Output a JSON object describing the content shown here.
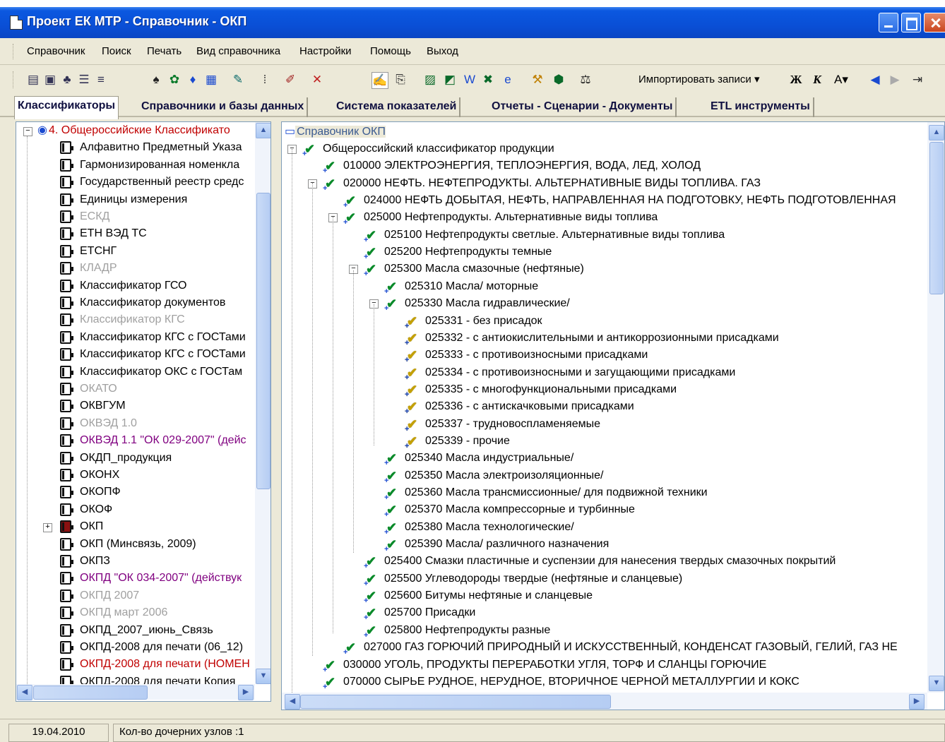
{
  "window": {
    "title": "Проект ЕК МТР - Справочник - ОКП"
  },
  "menu": [
    "Справочник",
    "Поиск",
    "Печать",
    "Вид справочника",
    "Настройки",
    "Помощь",
    "Выход"
  ],
  "toolbar": {
    "import_label": "Импортировать записи",
    "bold": "Ж",
    "italic": "К",
    "font": "А"
  },
  "tabs": [
    "Классификаторы",
    "Справочники и базы данных",
    "Система показателей",
    "Отчеты - Сценарии - Документы",
    "ETL инструменты"
  ],
  "left_tree": {
    "root": "4. Общероссийские Классификато",
    "items": [
      {
        "label": "Алфавитно Предметный Указа",
        "style": "normal"
      },
      {
        "label": "Гармонизированная номенкла",
        "style": "normal"
      },
      {
        "label": "Государственный реестр средс",
        "style": "normal"
      },
      {
        "label": "Единицы измерения",
        "style": "normal"
      },
      {
        "label": "ЕСКД",
        "style": "gray"
      },
      {
        "label": "ЕТН ВЭД ТС",
        "style": "normal"
      },
      {
        "label": "ЕТСНГ",
        "style": "normal"
      },
      {
        "label": "КЛАДР",
        "style": "gray"
      },
      {
        "label": "Классификатор ГСО",
        "style": "normal"
      },
      {
        "label": "Классификатор документов",
        "style": "normal"
      },
      {
        "label": "Классификатор КГС",
        "style": "gray"
      },
      {
        "label": "Классификатор КГС с ГОСТами",
        "style": "normal"
      },
      {
        "label": "Классификатор КГС с ГОСТами",
        "style": "normal"
      },
      {
        "label": "Классификатор ОКС с ГОСТам",
        "style": "normal"
      },
      {
        "label": "ОКАТО",
        "style": "gray"
      },
      {
        "label": "ОКВГУМ",
        "style": "normal"
      },
      {
        "label": "ОКВЭД 1.0",
        "style": "gray"
      },
      {
        "label": "ОКВЭД 1.1 \"ОК 029-2007\" (дейс",
        "style": "purple"
      },
      {
        "label": "ОКДП_продукция",
        "style": "normal"
      },
      {
        "label": "ОКОНХ",
        "style": "normal"
      },
      {
        "label": "ОКОПФ",
        "style": "normal"
      },
      {
        "label": "ОКОФ",
        "style": "normal"
      },
      {
        "label": "ОКП",
        "style": "selected"
      },
      {
        "label": "ОКП (Минсвязь, 2009)",
        "style": "normal"
      },
      {
        "label": "ОКПЗ",
        "style": "normal"
      },
      {
        "label": "ОКПД \"ОК 034-2007\" (действук",
        "style": "purple"
      },
      {
        "label": "ОКПД 2007",
        "style": "gray"
      },
      {
        "label": "ОКПД март 2006",
        "style": "gray"
      },
      {
        "label": "ОКПД_2007_июнь_Связь",
        "style": "normal"
      },
      {
        "label": "ОКПД-2008 для печати (06_12)",
        "style": "normal"
      },
      {
        "label": "ОКПД-2008 для печати (НОМЕН",
        "style": "red"
      },
      {
        "label": "ОКПД-2008 для печати Копия",
        "style": "normal"
      }
    ]
  },
  "right_tree": {
    "root": "Справочник ОКП",
    "items": [
      {
        "label": "Общероссийский классификатор продукции",
        "level": 0,
        "exp": "-",
        "icon": "green"
      },
      {
        "label": "010000 ЭЛЕКТРОЭНЕРГИЯ, ТЕПЛОЭНЕРГИЯ, ВОДА, ЛЕД, ХОЛОД",
        "level": 1,
        "exp": "",
        "icon": "green"
      },
      {
        "label": "020000 НЕФТЬ. НЕФТЕПРОДУКТЫ. АЛЬТЕРНАТИВНЫЕ ВИДЫ ТОПЛИВА. ГАЗ",
        "level": 1,
        "exp": "-",
        "icon": "green"
      },
      {
        "label": "024000 НЕФТЬ ДОБЫТАЯ, НЕФТЬ, НАПРАВЛЕННАЯ НА ПОДГОТОВКУ, НЕФТЬ ПОДГОТОВЛЕННАЯ",
        "level": 2,
        "exp": "",
        "icon": "green"
      },
      {
        "label": "025000 Нефтепродукты. Альтернативные виды топлива",
        "level": 2,
        "exp": "-",
        "icon": "green"
      },
      {
        "label": "025100 Нефтепродукты светлые. Альтернативные виды топлива",
        "level": 3,
        "exp": "",
        "icon": "green"
      },
      {
        "label": "025200 Нефтепродукты темные",
        "level": 3,
        "exp": "",
        "icon": "green"
      },
      {
        "label": "025300 Масла смазочные (нефтяные)",
        "level": 3,
        "exp": "-",
        "icon": "green"
      },
      {
        "label": "025310 Масла/ моторные",
        "level": 4,
        "exp": "",
        "icon": "green"
      },
      {
        "label": "025330 Масла гидравлические/",
        "level": 4,
        "exp": "-",
        "icon": "green"
      },
      {
        "label": "025331 - без присадок",
        "level": 5,
        "exp": "",
        "icon": "yellow"
      },
      {
        "label": "025332 - с антиокислительными и антикоррозионными присадками",
        "level": 5,
        "exp": "",
        "icon": "yellow"
      },
      {
        "label": "025333 - с противоизносными присадками",
        "level": 5,
        "exp": "",
        "icon": "yellow"
      },
      {
        "label": "025334 - с противоизносными и загущающими присадками",
        "level": 5,
        "exp": "",
        "icon": "yellow"
      },
      {
        "label": "025335 - с многофункциональными присадками",
        "level": 5,
        "exp": "",
        "icon": "yellow"
      },
      {
        "label": "025336 - с антискачковыми присадками",
        "level": 5,
        "exp": "",
        "icon": "yellow"
      },
      {
        "label": "025337 - трудновоспламеняемые",
        "level": 5,
        "exp": "",
        "icon": "yellow"
      },
      {
        "label": "025339 - прочие",
        "level": 5,
        "exp": "",
        "icon": "yellow"
      },
      {
        "label": "025340 Масла индустриальные/",
        "level": 4,
        "exp": "",
        "icon": "green"
      },
      {
        "label": "025350 Масла электроизоляционные/",
        "level": 4,
        "exp": "",
        "icon": "green"
      },
      {
        "label": "025360 Масла трансмиссионные/ для подвижной техники",
        "level": 4,
        "exp": "",
        "icon": "green"
      },
      {
        "label": "025370 Масла компрессорные и турбинные",
        "level": 4,
        "exp": "",
        "icon": "green"
      },
      {
        "label": "025380 Масла технологические/",
        "level": 4,
        "exp": "",
        "icon": "green"
      },
      {
        "label": "025390 Масла/ различного назначения",
        "level": 4,
        "exp": "",
        "icon": "green"
      },
      {
        "label": "025400 Смазки пластичные и суспензии для нанесения твердых смазочных покрытий",
        "level": 3,
        "exp": "",
        "icon": "green"
      },
      {
        "label": "025500 Углеводороды твердые (нефтяные и сланцевые)",
        "level": 3,
        "exp": "",
        "icon": "green"
      },
      {
        "label": "025600 Битумы нефтяные и сланцевые",
        "level": 3,
        "exp": "",
        "icon": "green"
      },
      {
        "label": "025700 Присадки",
        "level": 3,
        "exp": "",
        "icon": "green"
      },
      {
        "label": "025800 Нефтепродукты разные",
        "level": 3,
        "exp": "",
        "icon": "green"
      },
      {
        "label": "027000 ГАЗ ГОРЮЧИЙ ПРИРОДНЫЙ И ИСКУССТВЕННЫЙ, КОНДЕНСАТ ГАЗОВЫЙ, ГЕЛИЙ, ГАЗ НЕ",
        "level": 2,
        "exp": "",
        "icon": "green"
      },
      {
        "label": "030000 УГОЛЬ, ПРОДУКТЫ ПЕРЕРАБОТКИ УГЛЯ, ТОРФ И СЛАНЦЫ ГОРЮЧИЕ",
        "level": 1,
        "exp": "",
        "icon": "green"
      },
      {
        "label": "070000 СЫРЬЕ РУДНОЕ, НЕРУДНОЕ, ВТОРИЧНОЕ ЧЕРНОЙ МЕТАЛЛУРГИИ И КОКС",
        "level": 1,
        "exp": "",
        "icon": "green"
      }
    ]
  },
  "status": {
    "date": "19.04.2010",
    "message": "Кол-во дочерних узлов :1"
  },
  "colors": {
    "title_bar": "#0a4fd6",
    "gray_text": "#a0a0a0",
    "purple_text": "#800080",
    "red_text": "#c00000",
    "link_text": "#3a5a90"
  }
}
